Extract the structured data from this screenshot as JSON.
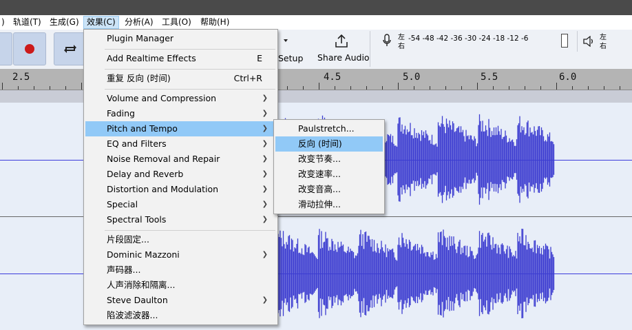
{
  "menubar": {
    "items": [
      {
        "label": ")"
      },
      {
        "label": "轨道(T)"
      },
      {
        "label": "生成(G)"
      },
      {
        "label": "效果(C)"
      },
      {
        "label": "分析(A)"
      },
      {
        "label": "工具(O)"
      },
      {
        "label": "帮助(H)"
      }
    ]
  },
  "toolbar": {
    "setup_label": "Setup",
    "share_label": "Share Audio",
    "meter_left": "左",
    "meter_right": "右",
    "meter_ticks": [
      "-54",
      "-48",
      "-42",
      "-36",
      "-30",
      "-24",
      "-18",
      "-12",
      "-6"
    ]
  },
  "ruler": {
    "labels": [
      "2.5",
      "4.5",
      "5.0",
      "5.5",
      "6.0"
    ]
  },
  "effects_menu": {
    "items": [
      {
        "label": "Plugin Manager",
        "shortcut": "",
        "submenu": false
      },
      {
        "label": "Add Realtime Effects",
        "shortcut": "E",
        "submenu": false
      },
      {
        "label": "重复 反向 (时间)",
        "shortcut": "Ctrl+R",
        "submenu": false
      },
      {
        "label": "Volume and Compression",
        "shortcut": "",
        "submenu": true
      },
      {
        "label": "Fading",
        "shortcut": "",
        "submenu": true
      },
      {
        "label": "Pitch and Tempo",
        "shortcut": "",
        "submenu": true
      },
      {
        "label": "EQ and Filters",
        "shortcut": "",
        "submenu": true
      },
      {
        "label": "Noise Removal and Repair",
        "shortcut": "",
        "submenu": true
      },
      {
        "label": "Delay and Reverb",
        "shortcut": "",
        "submenu": true
      },
      {
        "label": "Distortion and Modulation",
        "shortcut": "",
        "submenu": true
      },
      {
        "label": "Special",
        "shortcut": "",
        "submenu": true
      },
      {
        "label": "Spectral Tools",
        "shortcut": "",
        "submenu": true
      },
      {
        "label": "片段固定...",
        "shortcut": "",
        "submenu": false
      },
      {
        "label": "Dominic Mazzoni",
        "shortcut": "",
        "submenu": true
      },
      {
        "label": "声码器...",
        "shortcut": "",
        "submenu": false
      },
      {
        "label": "人声消除和隔离...",
        "shortcut": "",
        "submenu": false
      },
      {
        "label": "Steve Daulton",
        "shortcut": "",
        "submenu": true
      },
      {
        "label": "陷波滤波器...",
        "shortcut": "",
        "submenu": false
      }
    ]
  },
  "pitch_submenu": {
    "items": [
      {
        "label": "Paulstretch..."
      },
      {
        "label": "反向 (时间)"
      },
      {
        "label": "改变节奏..."
      },
      {
        "label": "改变速率..."
      },
      {
        "label": "改变音高..."
      },
      {
        "label": "滑动拉伸..."
      }
    ]
  },
  "colors": {
    "waveform": "#3c3cd0",
    "track_bg": "#e8eef8",
    "highlight": "#91c9f7",
    "record": "#cc1a1a"
  }
}
